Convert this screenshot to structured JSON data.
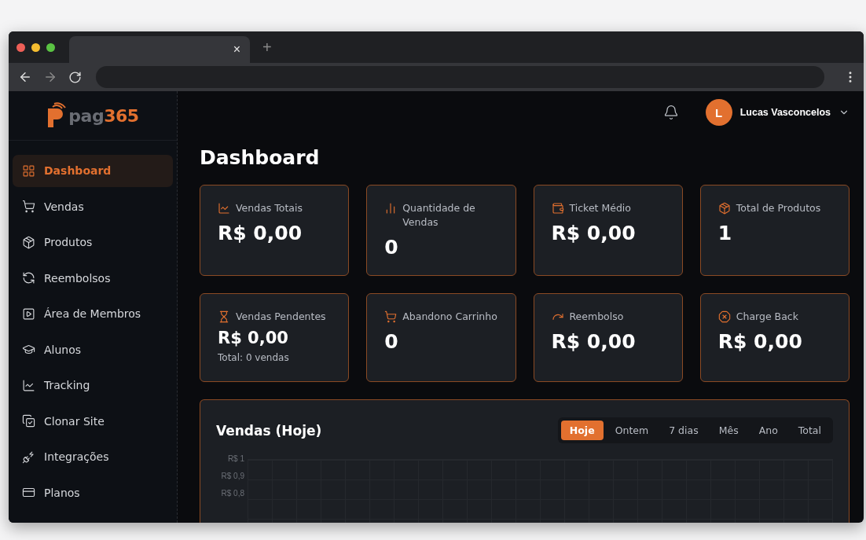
{
  "browser": {
    "tab_close": "×",
    "new_tab": "+"
  },
  "logo": {
    "text_dark": "pag",
    "text_accent": "365"
  },
  "sidebar": {
    "items": [
      {
        "label": "Dashboard",
        "selected": true
      },
      {
        "label": "Vendas",
        "selected": false
      },
      {
        "label": "Produtos",
        "selected": false
      },
      {
        "label": "Reembolsos",
        "selected": false
      },
      {
        "label": "Área de Membros",
        "selected": false
      },
      {
        "label": "Alunos",
        "selected": false
      },
      {
        "label": "Tracking",
        "selected": false
      },
      {
        "label": "Clonar Site",
        "selected": false
      },
      {
        "label": "Integrações",
        "selected": false
      },
      {
        "label": "Planos",
        "selected": false
      }
    ]
  },
  "header": {
    "avatar_initial": "L",
    "user_name": "Lucas Vasconcelos"
  },
  "page_title": "Dashboard",
  "stats": [
    {
      "label": "Vendas Totais",
      "value": "R$ 0,00"
    },
    {
      "label": "Quantidade de Vendas",
      "value": "0"
    },
    {
      "label": "Ticket Médio",
      "value": "R$ 0,00"
    },
    {
      "label": "Total de Produtos",
      "value": "1"
    },
    {
      "label": "Vendas Pendentes",
      "value": "R$ 0,00",
      "note": "Total: 0 vendas"
    },
    {
      "label": "Abandono Carrinho",
      "value": "0"
    },
    {
      "label": "Reembolso",
      "value": "R$ 0,00"
    },
    {
      "label": "Charge Back",
      "value": "R$ 0,00"
    }
  ],
  "sales_panel": {
    "title": "Vendas (Hoje)",
    "ranges": [
      {
        "label": "Hoje",
        "selected": true
      },
      {
        "label": "Ontem",
        "selected": false
      },
      {
        "label": "7 dias",
        "selected": false
      },
      {
        "label": "Mês",
        "selected": false
      },
      {
        "label": "Ano",
        "selected": false
      },
      {
        "label": "Total",
        "selected": false
      }
    ],
    "y_axis_labels": [
      "R$ 1",
      "R$ 0,9",
      "R$ 0,8"
    ]
  }
}
